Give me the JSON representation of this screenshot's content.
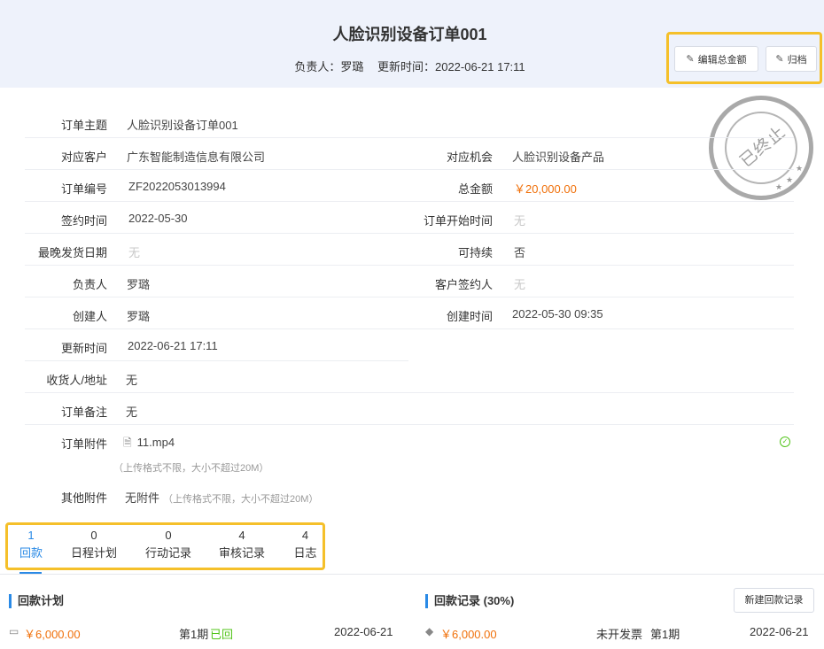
{
  "header": {
    "title": "人脸识别设备订单001",
    "owner_label": "负责人：",
    "owner": "罗璐",
    "updated_label": "更新时间：",
    "updated": "2022-06-21 17:11",
    "edit_total_label": "编辑总金额",
    "archive_label": "归档"
  },
  "stamp": {
    "text": "已终止"
  },
  "fields": {
    "subject": {
      "label": "订单主题",
      "value": "人脸识别设备订单001"
    },
    "customer": {
      "label": "对应客户",
      "value": "广东智能制造信息有限公司"
    },
    "opportunity": {
      "label": "对应机会",
      "value": "人脸识别设备产品"
    },
    "order_no": {
      "label": "订单编号",
      "value": "ZF2022053013994"
    },
    "total": {
      "label": "总金额",
      "value": "￥20,000.00"
    },
    "sign_date": {
      "label": "签约时间",
      "value": "2022-05-30"
    },
    "start_date": {
      "label": "订单开始时间",
      "value": "无"
    },
    "latest_ship": {
      "label": "最晚发货日期",
      "value": "无"
    },
    "sustainable": {
      "label": "可持续",
      "value": "否"
    },
    "owner": {
      "label": "负责人",
      "value": "罗璐"
    },
    "customer_signer": {
      "label": "客户签约人",
      "value": "无"
    },
    "creator": {
      "label": "创建人",
      "value": "罗璐"
    },
    "created_time": {
      "label": "创建时间",
      "value": "2022-05-30 09:35"
    },
    "updated_time": {
      "label": "更新时间",
      "value": "2022-06-21 17:11"
    },
    "receiver": {
      "label": "收货人/地址",
      "value": "无"
    },
    "remark": {
      "label": "订单备注",
      "value": "无"
    },
    "attachment": {
      "label": "订单附件",
      "file": "11.mp4",
      "hint": "（上传格式不限，大小不超过20M）"
    },
    "other_attachment": {
      "label": "其他附件",
      "value": "无附件",
      "hint": "（上传格式不限，大小不超过20M）"
    }
  },
  "tabs": [
    {
      "count": "1",
      "label": "回款"
    },
    {
      "count": "0",
      "label": "日程计划"
    },
    {
      "count": "0",
      "label": "行动记录"
    },
    {
      "count": "4",
      "label": "审核记录"
    },
    {
      "count": "4",
      "label": "日志"
    }
  ],
  "payment_plan": {
    "title": "回款计划",
    "amount": "￥6,000.00",
    "period": "第1期",
    "status": "已回",
    "date": "2022-06-21"
  },
  "payment_record": {
    "title": "回款记录 (30%)",
    "new_button": "新建回款记录",
    "amount": "￥6,000.00",
    "invoice": "未开发票",
    "period": "第1期",
    "date": "2022-06-21"
  },
  "colors": {
    "accent": "#2a8ae6",
    "amount": "#f0700a",
    "highlight": "#f5c02a",
    "success": "#52c41a"
  }
}
